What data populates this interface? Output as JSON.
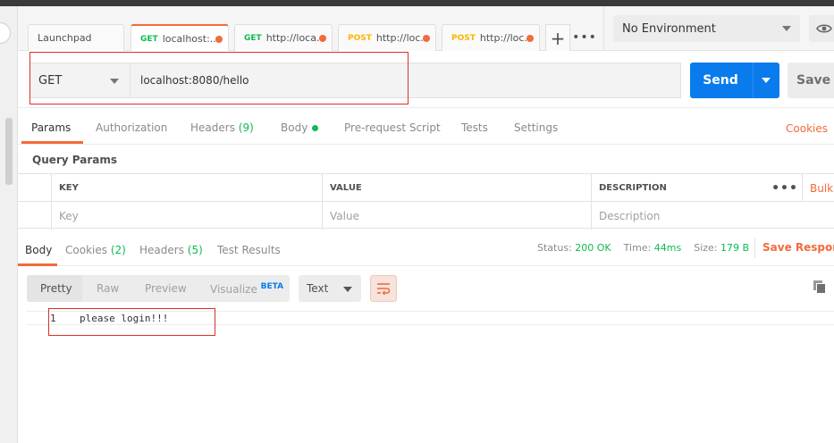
{
  "tabs": [
    {
      "label": "Launchpad",
      "method": "",
      "active": false,
      "dot": false
    },
    {
      "label": "localhost:...",
      "method": "GET",
      "active": true,
      "dot": true
    },
    {
      "label": "http://loca...",
      "method": "GET",
      "active": false,
      "dot": true
    },
    {
      "label": "http://loc...",
      "method": "POST",
      "active": false,
      "dot": true
    },
    {
      "label": "http://loc...",
      "method": "POST",
      "active": false,
      "dot": true
    }
  ],
  "tab_controls": {
    "add": "+",
    "more": "•••"
  },
  "environment": {
    "selected": "No Environment"
  },
  "request": {
    "method": "GET",
    "url": "localhost:8080/hello",
    "send_label": "Send",
    "save_label": "Save"
  },
  "request_tabs": {
    "params": "Params",
    "authorization": "Authorization",
    "headers": "Headers",
    "headers_count": "(9)",
    "body": "Body",
    "prerequest": "Pre-request Script",
    "tests": "Tests",
    "settings": "Settings",
    "cookies": "Cookies"
  },
  "query_params": {
    "title": "Query Params",
    "columns": [
      "KEY",
      "VALUE",
      "DESCRIPTION"
    ],
    "more": "•••",
    "bulk": "Bulk",
    "placeholders": [
      "Key",
      "Value",
      "Description"
    ]
  },
  "response_tabs": {
    "body": "Body",
    "cookies": "Cookies",
    "cookies_count": "(2)",
    "headers": "Headers",
    "headers_count": "(5)",
    "test_results": "Test Results"
  },
  "response_status": {
    "status_label": "Status:",
    "status_value": "200 OK",
    "time_label": "Time:",
    "time_value": "44ms",
    "size_label": "Size:",
    "size_value": "179 B",
    "save_response": "Save Respons"
  },
  "view_options": {
    "pretty": "Pretty",
    "raw": "Raw",
    "preview": "Preview",
    "visualize": "Visualize",
    "beta": "BETA",
    "format": "Text"
  },
  "response_body": {
    "line_number": "1",
    "line_text": "please login!!!"
  },
  "colors": {
    "accent": "#f26b3a",
    "send": "#097bed",
    "get": "#0cbb52",
    "post": "#ffb400",
    "annotation": "#d9302b"
  }
}
